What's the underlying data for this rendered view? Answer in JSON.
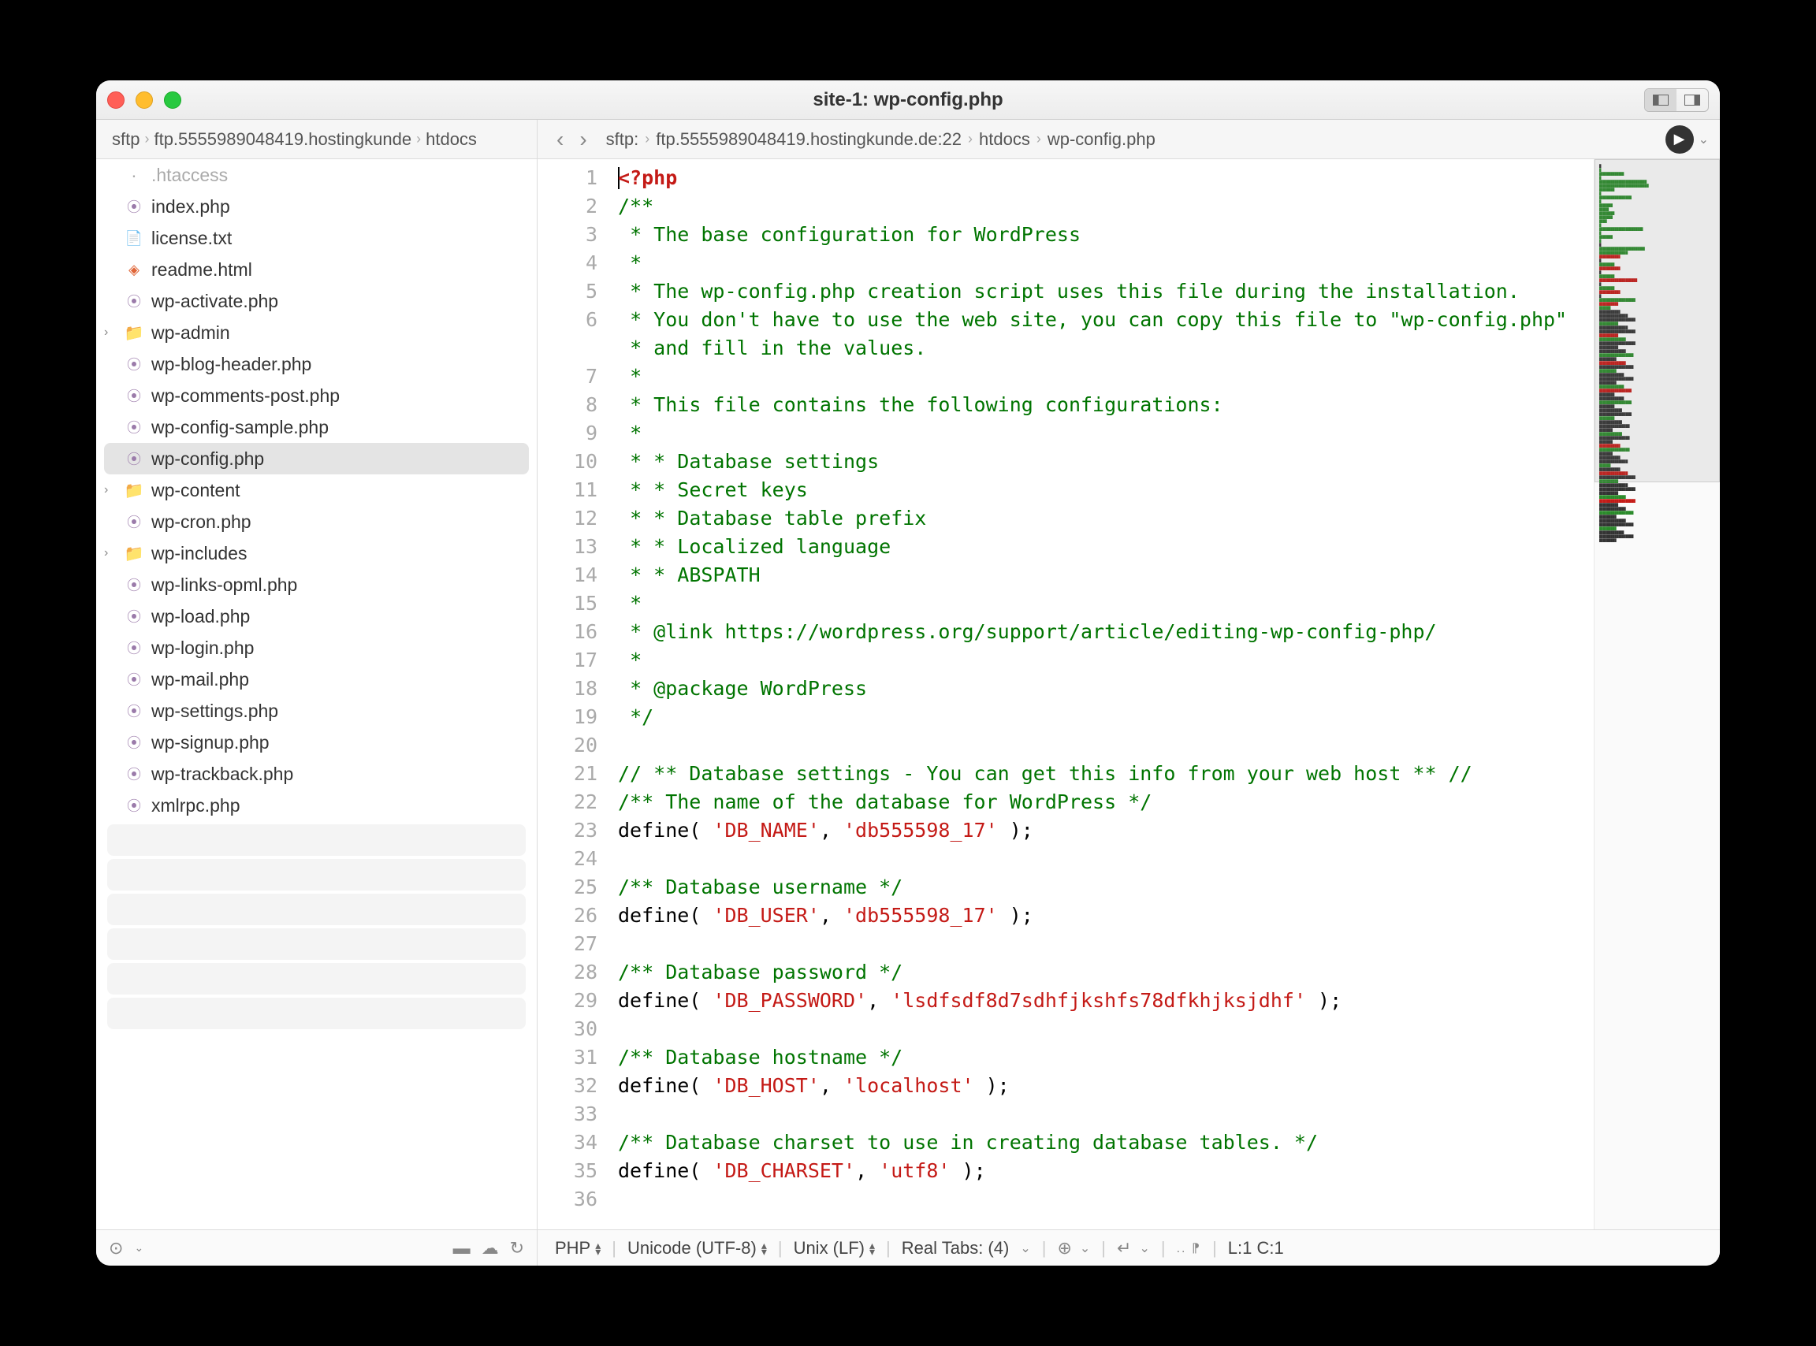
{
  "window": {
    "title": "site-1: wp-config.php"
  },
  "sidebar_crumb": [
    "sftp",
    "ftp.5555989048419.hostingkunde",
    "htdocs"
  ],
  "editor_crumb": [
    "sftp:",
    "ftp.5555989048419.hostingkunde.de:22",
    "htdocs",
    "wp-config.php"
  ],
  "files": [
    {
      "name": ".htaccess",
      "type": "hidden"
    },
    {
      "name": "index.php",
      "type": "php"
    },
    {
      "name": "license.txt",
      "type": "txt"
    },
    {
      "name": "readme.html",
      "type": "html"
    },
    {
      "name": "wp-activate.php",
      "type": "php"
    },
    {
      "name": "wp-admin",
      "type": "folder"
    },
    {
      "name": "wp-blog-header.php",
      "type": "php"
    },
    {
      "name": "wp-comments-post.php",
      "type": "php"
    },
    {
      "name": "wp-config-sample.php",
      "type": "php"
    },
    {
      "name": "wp-config.php",
      "type": "php",
      "selected": true
    },
    {
      "name": "wp-content",
      "type": "folder"
    },
    {
      "name": "wp-cron.php",
      "type": "php"
    },
    {
      "name": "wp-includes",
      "type": "folder"
    },
    {
      "name": "wp-links-opml.php",
      "type": "php"
    },
    {
      "name": "wp-load.php",
      "type": "php"
    },
    {
      "name": "wp-login.php",
      "type": "php"
    },
    {
      "name": "wp-mail.php",
      "type": "php"
    },
    {
      "name": "wp-settings.php",
      "type": "php"
    },
    {
      "name": "wp-signup.php",
      "type": "php"
    },
    {
      "name": "wp-trackback.php",
      "type": "php"
    },
    {
      "name": "xmlrpc.php",
      "type": "php"
    }
  ],
  "placeholder_rows": 6,
  "code": {
    "rows": [
      {
        "n": 1,
        "parts": [
          {
            "t": "<?php",
            "c": "tag"
          }
        ]
      },
      {
        "n": 2,
        "parts": [
          {
            "t": "/**",
            "c": "comment"
          }
        ]
      },
      {
        "n": 3,
        "parts": [
          {
            "t": " * The base configuration for WordPress",
            "c": "comment"
          }
        ]
      },
      {
        "n": 4,
        "parts": [
          {
            "t": " *",
            "c": "comment"
          }
        ]
      },
      {
        "n": 5,
        "parts": [
          {
            "t": " * The wp-config.php creation script uses this file during the installation.",
            "c": "comment"
          }
        ]
      },
      {
        "n": 6,
        "parts": [
          {
            "t": " * You don't have to use the web site, you can copy this file to \"wp-config.php\"",
            "c": "comment"
          }
        ],
        "wrap": true
      },
      {
        "n": 7,
        "parts": [
          {
            "t": " * and fill in the values.",
            "c": "comment"
          }
        ]
      },
      {
        "n": 8,
        "parts": [
          {
            "t": " *",
            "c": "comment"
          }
        ]
      },
      {
        "n": 9,
        "parts": [
          {
            "t": " * This file contains the following configurations:",
            "c": "comment"
          }
        ]
      },
      {
        "n": 10,
        "parts": [
          {
            "t": " *",
            "c": "comment"
          }
        ]
      },
      {
        "n": 11,
        "parts": [
          {
            "t": " * * Database settings",
            "c": "comment"
          }
        ]
      },
      {
        "n": 12,
        "parts": [
          {
            "t": " * * Secret keys",
            "c": "comment"
          }
        ]
      },
      {
        "n": 13,
        "parts": [
          {
            "t": " * * Database table prefix",
            "c": "comment"
          }
        ]
      },
      {
        "n": 14,
        "parts": [
          {
            "t": " * * Localized language",
            "c": "comment"
          }
        ]
      },
      {
        "n": 15,
        "parts": [
          {
            "t": " * * ABSPATH",
            "c": "comment"
          }
        ]
      },
      {
        "n": 16,
        "parts": [
          {
            "t": " *",
            "c": "comment"
          }
        ]
      },
      {
        "n": 17,
        "parts": [
          {
            "t": " * @link https://wordpress.org/support/article/editing-wp-config-php/",
            "c": "comment"
          }
        ]
      },
      {
        "n": 18,
        "parts": [
          {
            "t": " *",
            "c": "comment"
          }
        ]
      },
      {
        "n": 19,
        "parts": [
          {
            "t": " * @package WordPress",
            "c": "comment"
          }
        ]
      },
      {
        "n": 20,
        "parts": [
          {
            "t": " */",
            "c": "comment"
          }
        ]
      },
      {
        "n": 21,
        "parts": [
          {
            "t": "",
            "c": "plain"
          }
        ]
      },
      {
        "n": 22,
        "parts": [
          {
            "t": "// ** Database settings - You can get this info from your web host ** //",
            "c": "comment"
          }
        ]
      },
      {
        "n": 23,
        "parts": [
          {
            "t": "/** The name of the database for WordPress */",
            "c": "comment"
          }
        ]
      },
      {
        "n": 24,
        "parts": [
          {
            "t": "define( ",
            "c": "plain"
          },
          {
            "t": "'DB_NAME'",
            "c": "string"
          },
          {
            "t": ", ",
            "c": "plain"
          },
          {
            "t": "'db555598_17'",
            "c": "string"
          },
          {
            "t": " );",
            "c": "plain"
          }
        ]
      },
      {
        "n": 25,
        "parts": [
          {
            "t": "",
            "c": "plain"
          }
        ]
      },
      {
        "n": 26,
        "parts": [
          {
            "t": "/** Database username */",
            "c": "comment"
          }
        ]
      },
      {
        "n": 27,
        "parts": [
          {
            "t": "define( ",
            "c": "plain"
          },
          {
            "t": "'DB_USER'",
            "c": "string"
          },
          {
            "t": ", ",
            "c": "plain"
          },
          {
            "t": "'db555598_17'",
            "c": "string"
          },
          {
            "t": " );",
            "c": "plain"
          }
        ]
      },
      {
        "n": 28,
        "parts": [
          {
            "t": "",
            "c": "plain"
          }
        ]
      },
      {
        "n": 29,
        "parts": [
          {
            "t": "/** Database password */",
            "c": "comment"
          }
        ]
      },
      {
        "n": 30,
        "parts": [
          {
            "t": "define( ",
            "c": "plain"
          },
          {
            "t": "'DB_PASSWORD'",
            "c": "string"
          },
          {
            "t": ", ",
            "c": "plain"
          },
          {
            "t": "'lsdfsdf8d7sdhfjkshfs78dfkhjksjdhf'",
            "c": "string"
          },
          {
            "t": " );",
            "c": "plain"
          }
        ]
      },
      {
        "n": 31,
        "parts": [
          {
            "t": "",
            "c": "plain"
          }
        ]
      },
      {
        "n": 32,
        "parts": [
          {
            "t": "/** Database hostname */",
            "c": "comment"
          }
        ]
      },
      {
        "n": 33,
        "parts": [
          {
            "t": "define( ",
            "c": "plain"
          },
          {
            "t": "'DB_HOST'",
            "c": "string"
          },
          {
            "t": ", ",
            "c": "plain"
          },
          {
            "t": "'localhost'",
            "c": "string"
          },
          {
            "t": " );",
            "c": "plain"
          }
        ]
      },
      {
        "n": 34,
        "parts": [
          {
            "t": "",
            "c": "plain"
          }
        ]
      },
      {
        "n": 35,
        "parts": [
          {
            "t": "/** Database charset to use in creating database tables. */",
            "c": "comment"
          }
        ]
      },
      {
        "n": 36,
        "parts": [
          {
            "t": "define( ",
            "c": "plain"
          },
          {
            "t": "'DB_CHARSET'",
            "c": "string"
          },
          {
            "t": ", ",
            "c": "plain"
          },
          {
            "t": "'utf8'",
            "c": "string"
          },
          {
            "t": " );",
            "c": "plain"
          }
        ],
        "cut": true
      }
    ]
  },
  "status": {
    "language": "PHP",
    "encoding": "Unicode (UTF-8)",
    "line_endings": "Unix (LF)",
    "indent": "Real Tabs: (4)",
    "position": "L:1 C:1"
  }
}
